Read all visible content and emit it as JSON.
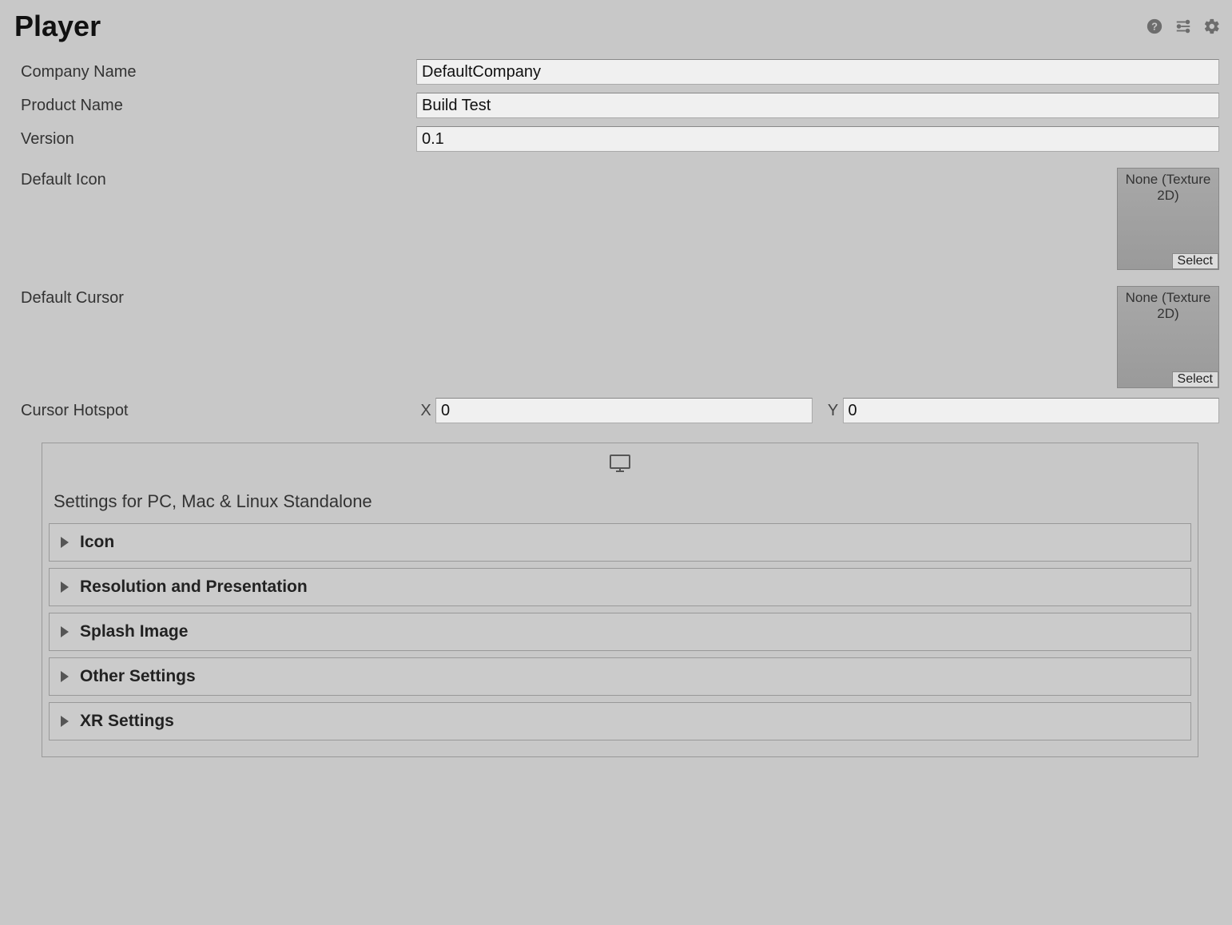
{
  "header": {
    "title": "Player"
  },
  "fields": {
    "company_label": "Company Name",
    "company_value": "DefaultCompany",
    "product_label": "Product Name",
    "product_value": "Build Test",
    "version_label": "Version",
    "version_value": "0.1",
    "default_icon_label": "Default Icon",
    "default_cursor_label": "Default Cursor",
    "texture_none": "None (Texture 2D)",
    "select_btn": "Select",
    "cursor_hotspot_label": "Cursor Hotspot",
    "x_label": "X",
    "y_label": "Y",
    "x_value": "0",
    "y_value": "0"
  },
  "platform": {
    "settings_title": "Settings for PC, Mac & Linux Standalone",
    "foldouts": [
      "Icon",
      "Resolution and Presentation",
      "Splash Image",
      "Other Settings",
      "XR Settings"
    ]
  }
}
